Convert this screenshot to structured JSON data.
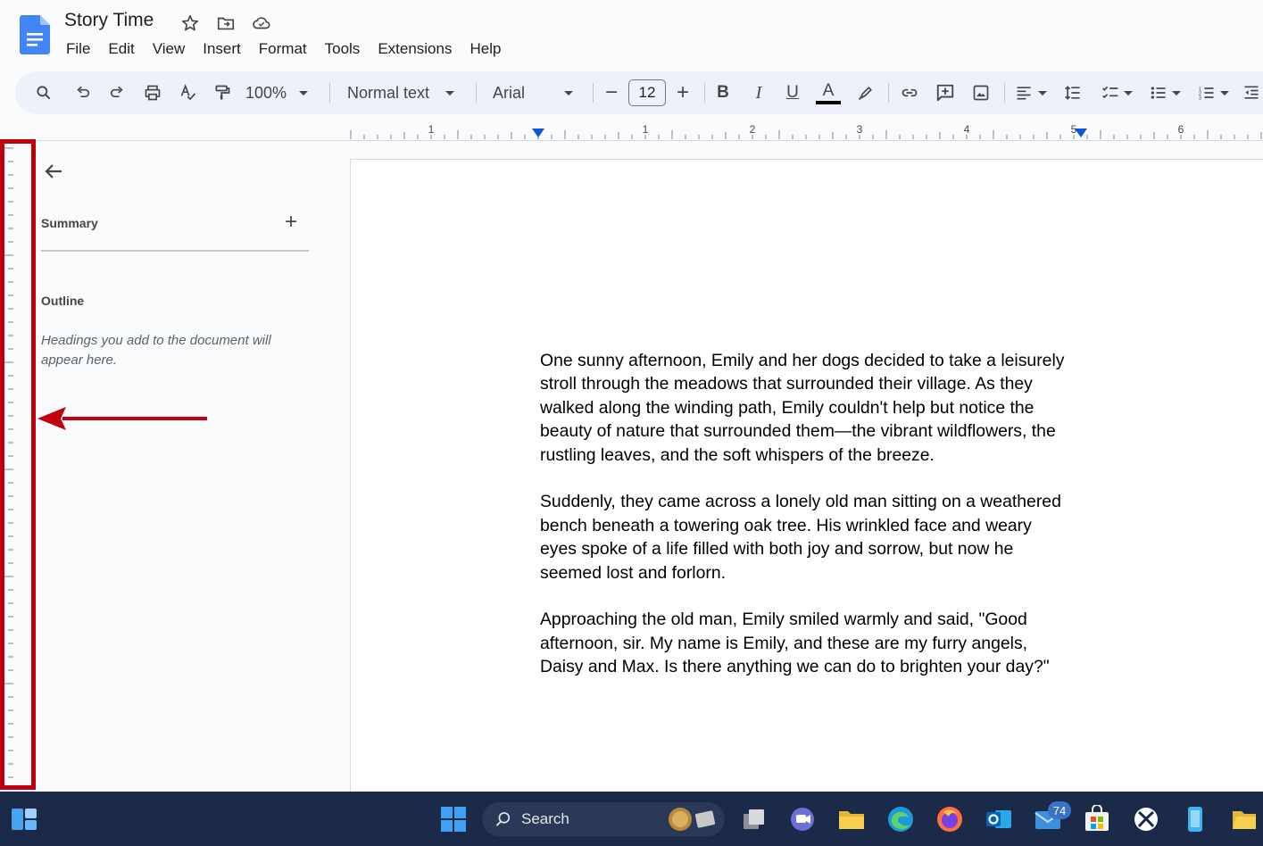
{
  "document": {
    "title": "Story Time"
  },
  "menu": [
    "File",
    "Edit",
    "View",
    "Insert",
    "Format",
    "Tools",
    "Extensions",
    "Help"
  ],
  "toolbar": {
    "zoom": "100%",
    "style": "Normal text",
    "font": "Arial",
    "font_size": "12",
    "minus": "−",
    "plus": "+"
  },
  "ruler": {
    "numbers": [
      "1",
      "1",
      "2",
      "3",
      "4",
      "5",
      "6"
    ]
  },
  "sidebar": {
    "summary_label": "Summary",
    "add_symbol": "+",
    "outline_label": "Outline",
    "outline_hint": "Headings you add to the document will appear here."
  },
  "body": {
    "paragraphs": [
      "One sunny afternoon, Emily and her dogs decided to take a leisurely\nstroll through the meadows that surrounded their village. As they\nwalked along the winding path, Emily couldn't help but notice the\nbeauty of nature that surrounded them—the vibrant wildflowers, the\nrustling leaves, and the soft whispers of the breeze.",
      "Suddenly, they came across a lonely old man sitting on a weathered\nbench beneath a towering oak tree. His wrinkled face and weary\neyes spoke of a life filled with both joy and sorrow, but now he\nseemed lost and forlorn.",
      "Approaching the old man, Emily smiled warmly and said, \"Good\nafternoon, sir. My name is Emily, and these are my furry angels,\nDaisy and Max. Is there anything we can do to brighten your day?\""
    ]
  },
  "taskbar": {
    "search_label": "Search",
    "mail_badge": "74"
  },
  "colors": {
    "accent": "#0b57d0",
    "highlight": "#c0000b",
    "taskbar": "#1c2a4a"
  }
}
